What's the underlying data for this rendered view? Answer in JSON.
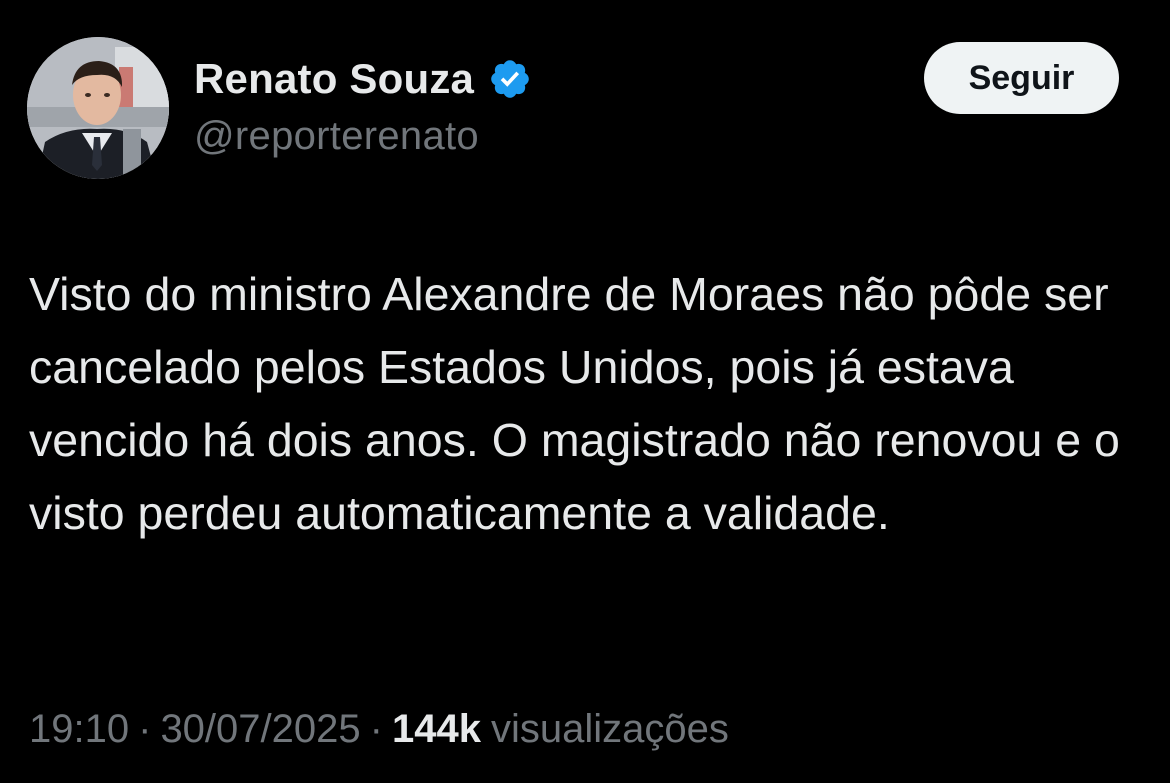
{
  "author": {
    "display_name": "Renato Souza",
    "handle": "@reporterenato",
    "verified": true,
    "verified_color": "#1d9bf0"
  },
  "actions": {
    "follow_label": "Seguir"
  },
  "tweet": {
    "text": "Visto do ministro Alexandre de Moraes não pôde ser cancelado pelos Estados Unidos, pois já estava vencido há dois anos. O magistrado não renovou e o visto perdeu automaticamente a validade.",
    "time": "19:10",
    "date": "30/07/2025",
    "separator": "·",
    "views_count": "144k",
    "views_label": "visualizações"
  },
  "theme": {
    "background": "#000000",
    "text_primary": "#e7e9ea",
    "text_secondary": "#71767b",
    "button_bg": "#eff3f4"
  }
}
